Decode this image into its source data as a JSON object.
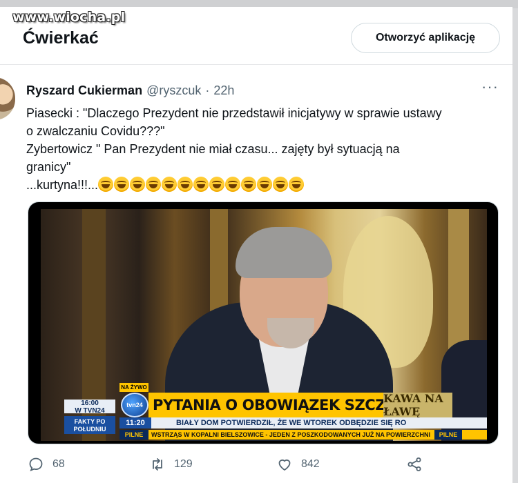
{
  "watermark": "www.wiocha.pl",
  "header": {
    "title": "Ćwierkać",
    "open_app_label": "Otworzyć aplikację"
  },
  "tweet": {
    "author": "Ryszard Cukierman",
    "handle": "@ryszcuk",
    "separator": "·",
    "time": "22h",
    "more_label": "···",
    "lines": [
      "Piasecki : \"Dlaczego Prezydent nie przedstawił inicjatywy w sprawie ustawy",
      "o zwalczaniu Covidu???\"",
      "Zybertowicz \" Pan Prezydent nie miał czasu... zajęty był sytuacją na",
      "granicy\"",
      "...kurtyna!!!..."
    ],
    "emoji_name": "face-with-tears-of-joy",
    "emoji_count": 13
  },
  "media": {
    "live_tag": "NA ŻYWO",
    "clock_time": "16:00",
    "clock_channel": "W TVN24",
    "program_side": "FAKTY PO POŁUDNIU",
    "channel_logo": "tvn24",
    "headline": "PYTANIA O OBOWIĄZEK SZCZEPIEŃ",
    "program_badge": "KAWA NA ŁAWĘ",
    "ticker_time": "11:20",
    "ticker_text": "BIAŁY DOM POTWIERDZIŁ, ŻE WE WTOREK ODBĘDZIE SIĘ RO",
    "urgent_tag": "PILNE",
    "urgent_text": "WSTRZĄS W KOPALNI BIELSZOWICE - JEDEN Z POSZKODOWANYCH JUŻ NA POWIERZCHNI",
    "urgent_tag2": "PILNE"
  },
  "actions": {
    "replies": "68",
    "retweets": "129",
    "likes": "842",
    "icons": [
      "reply-icon",
      "retweet-icon",
      "like-icon",
      "share-icon"
    ]
  },
  "colors": {
    "text": "#0f1419",
    "secondary": "#536471",
    "border": "#cfd9de",
    "ticker_yellow": "#ffc400",
    "tvn_blue": "#1a4fa0"
  }
}
